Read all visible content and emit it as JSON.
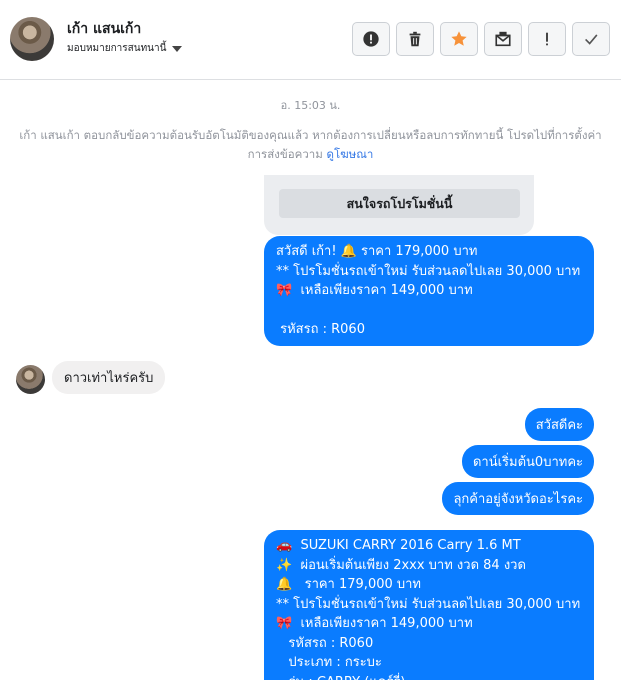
{
  "header": {
    "contact_name": "เก้า แสนเก้า",
    "assign_label": "มอบหมายการสนทนานี้",
    "actions": [
      {
        "name": "mark-spam-button",
        "icon": "alert-circle-icon"
      },
      {
        "name": "delete-button",
        "icon": "trash-icon"
      },
      {
        "name": "star-button",
        "icon": "star-icon"
      },
      {
        "name": "mark-unread-button",
        "icon": "envelope-icon"
      },
      {
        "name": "flag-button",
        "icon": "exclamation-icon"
      },
      {
        "name": "done-button",
        "icon": "check-icon"
      }
    ]
  },
  "thread": {
    "timestamp": "อ. 15:03 น.",
    "notice_text": "เก้า แสนเก้า ตอบกลับข้อความต้อนรับอัตโนมัติของคุณแล้ว หากต้องการเปลี่ยนหรือลบการทักทายนี้ โปรดไปที่การตั้งค่าการส่งข้อความ",
    "notice_link": "ดูโฆษณา",
    "card_button": "สนใจรถโปรโมชั่นนี้",
    "msg1": "สวัสดี เก้า! 🔔 ราคา 179,000 บาท\n** โปรโมชั่นรถเข้าใหม่ รับส่วนลดไปเลย 30,000 บาท\n🎀  เหลือเพียงราคา 149,000 บาท\n\n รหัสรถ : R060",
    "incoming": "ดาวเท่าไหร่ครับ",
    "reply1": "สวัสดีคะ",
    "reply2": "ดาน์เริ่มต้น0บาทคะ",
    "reply3": "ลุกค้าอยู่จังหวัดอะไรคะ",
    "msg2": "🚗  SUZUKI CARRY 2016 Carry 1.6 MT\n✨  ผ่อนเริ่มต้นเพียง 2xxx บาท งวด 84 งวด\n🔔   ราคา 179,000 บาท\n** โปรโมชั่นรถเข้าใหม่ รับส่วนลดไปเลย 30,000 บาท\n🎀  เหลือเพียงราคา 149,000 บาท\n   รหัสรถ : R060\n   ประเภท : กระบะ\n   รุ่น : CARRY (แคร์รี่)"
  },
  "colors": {
    "outgoing_bubble": "#0a7cff",
    "incoming_bubble": "#f1f0f0",
    "star": "#f7923a"
  }
}
